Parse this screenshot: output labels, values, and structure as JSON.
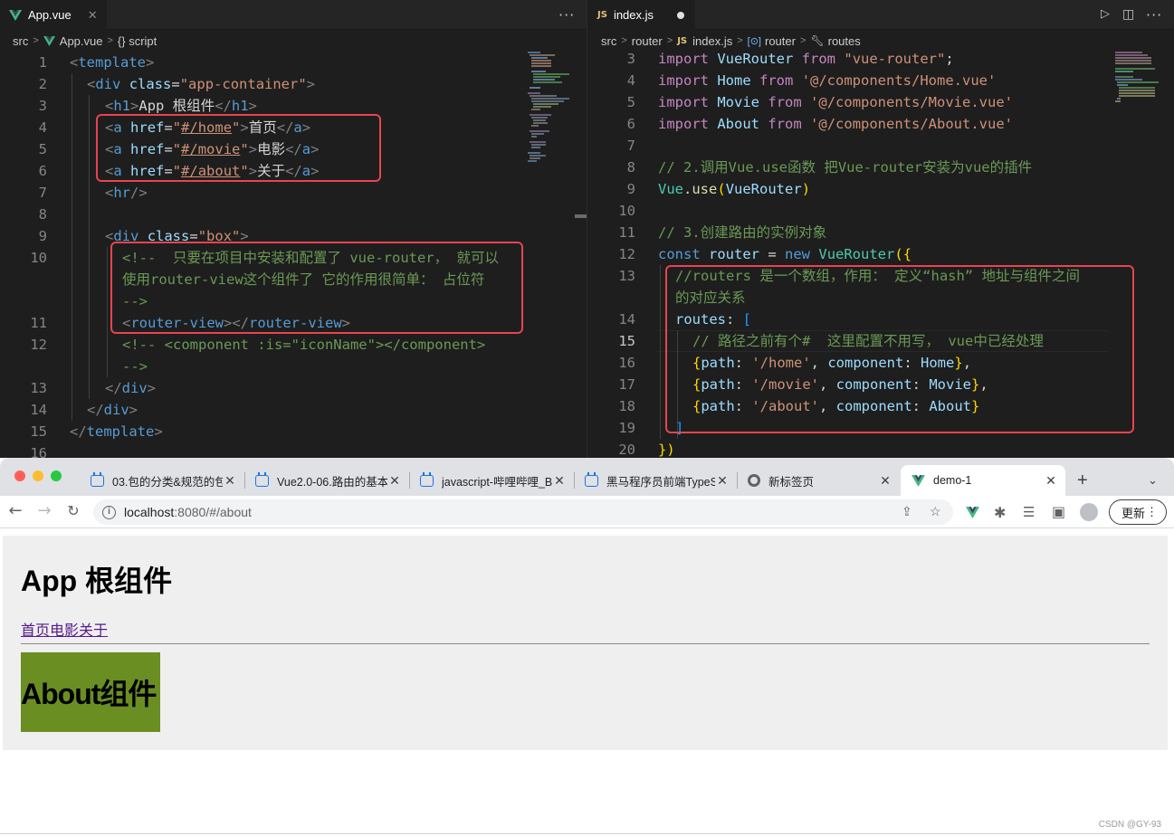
{
  "left_editor": {
    "tab_title": "App.vue",
    "breadcrumb": [
      "src",
      "App.vue",
      "{} script"
    ],
    "line_numbers": [
      "1",
      "2",
      "3",
      "4",
      "5",
      "6",
      "7",
      "8",
      "9",
      "10",
      "11",
      "12",
      "13",
      "14",
      "15",
      "16"
    ],
    "code": {
      "l1": [
        "<",
        "template",
        ">"
      ],
      "l2": [
        "<",
        "div",
        " ",
        "class",
        "=",
        "\"app-container\"",
        ">"
      ],
      "l3": [
        "<",
        "h1",
        ">",
        "App 根组件",
        "</",
        "h1",
        ">"
      ],
      "l4": [
        "<",
        "a",
        " ",
        "href",
        "=",
        "\"",
        "#/home",
        "\"",
        ">",
        "首页",
        "</",
        "a",
        ">"
      ],
      "l5": [
        "<",
        "a",
        " ",
        "href",
        "=",
        "\"",
        "#/movie",
        "\"",
        ">",
        "电影",
        "</",
        "a",
        ">"
      ],
      "l6": [
        "<",
        "a",
        " ",
        "href",
        "=",
        "\"",
        "#/about",
        "\"",
        ">",
        "关于",
        "</",
        "a",
        ">"
      ],
      "l7": [
        "<",
        "hr",
        "/>"
      ],
      "l9": [
        "<",
        "div",
        " ",
        "class",
        "=",
        "\"box\"",
        ">"
      ],
      "l10a": "<!--  只要在项目中安装和配置了 vue-router， 就可以",
      "l10b": "使用router-view这个组件了 它的作用很简单： 占位符",
      "l10c": "-->",
      "l11": [
        "<",
        "router-view",
        "></",
        "router-view",
        ">"
      ],
      "l12a": "<!-- <component :is=\"iconName\"></component>",
      "l12b": "-->",
      "l13": [
        "</",
        "div",
        ">"
      ],
      "l14": [
        "</",
        "div",
        ">"
      ],
      "l15": [
        "</",
        "template",
        ">"
      ]
    }
  },
  "right_editor": {
    "tab_title": "index.js",
    "breadcrumb": [
      "src",
      "router",
      "index.js",
      "router",
      "routes"
    ],
    "line_numbers": [
      "3",
      "4",
      "5",
      "6",
      "7",
      "8",
      "9",
      "10",
      "11",
      "12",
      "13",
      "",
      "14",
      "15",
      "16",
      "17",
      "18",
      "19",
      "20"
    ],
    "code": {
      "import_kw": "import",
      "from_kw": "from",
      "l3_name": "VueRouter",
      "l3_src": "\"vue-router\"",
      "l3_end": ";",
      "l4_name": "Home",
      "l4_src": "'@/components/Home.vue'",
      "l5_name": "Movie",
      "l5_src": "'@/components/Movie.vue'",
      "l6_name": "About",
      "l6_src": "'@/components/About.vue'",
      "l8": "// 2.调用Vue.use函数 把Vue-router安装为vue的插件",
      "l9_obj": "Vue",
      "l9_dot": ".",
      "l9_fn": "use",
      "l9_open": "(",
      "l9_arg": "VueRouter",
      "l9_close": ")",
      "l11": "// 3.创建路由的实例对象",
      "l12_const": "const",
      "l12_var": "router",
      "l12_eq": " = ",
      "l12_new": "new",
      "l12_cls": "VueRouter",
      "l12_open": "({",
      "l13a": "//routers 是一个数组，作用： 定义“hash” 地址与组件之间",
      "l13b": "的对应关系",
      "l14_key": "routes",
      "l14_colon": ": ",
      "l14_open": "[",
      "l15": "// 路径之前有个#  这里配置不用写， vue中已经处理",
      "path_key": "path",
      "component_key": "component",
      "l16_path": "'/home'",
      "l16_comp": "Home",
      "l17_path": "'/movie'",
      "l17_comp": "Movie",
      "l18_path": "'/about'",
      "l18_comp": "About",
      "l19": "]",
      "l20": "})"
    }
  },
  "browser": {
    "tabs": [
      {
        "title": "03.包的分类&规范的包"
      },
      {
        "title": "Vue2.0-06.路由的基本"
      },
      {
        "title": "javascript-哔哩哔哩_B"
      },
      {
        "title": "黑马程序员前端TypeS"
      },
      {
        "title": "新标签页"
      },
      {
        "title": "demo-1"
      }
    ],
    "new_tab": "+",
    "url_host": "localhost",
    "url_rest": ":8080/#/about",
    "update_label": "更新"
  },
  "page": {
    "h1": "App 根组件",
    "links": [
      "首页",
      "电影",
      "关于"
    ],
    "about_text": "About组件"
  },
  "watermark": "CSDN @GY-93",
  "colors": {
    "highlight_box": "#e8444f",
    "about_bg": "#6b8e23",
    "container_bg": "#efefef"
  }
}
